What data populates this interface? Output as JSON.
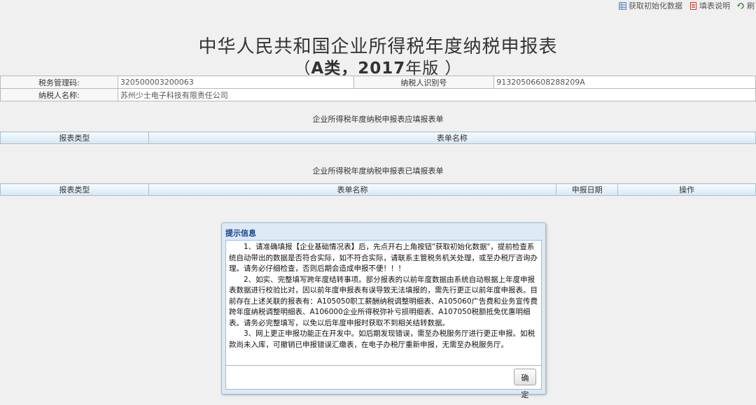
{
  "toolbar": {
    "init_data": "获取初始化数据",
    "instructions": "填表说明",
    "refresh": "刷"
  },
  "header": {
    "title": "中华人民共和国企业所得税年度纳税申报表",
    "subtitle_open": "（",
    "subtitle_type": "A类，2017",
    "subtitle_suffix": "年版 ）"
  },
  "taxpayer": {
    "tax_code_label": "税务管理码:",
    "tax_code_value": "320500003200063",
    "tax_id_label": "纳税人识别号",
    "tax_id_value": "91320506608288209A",
    "name_label": "纳税人名称:",
    "name_value": "苏州少士电子科技有限责任公司"
  },
  "pending_section": {
    "caption": "企业所得税年度纳税申报表应填报表单",
    "col_type": "报表类型",
    "col_name": "表单名称"
  },
  "filed_section": {
    "caption": "企业所得税年度纳税申报表已填报表单",
    "col_type": "报表类型",
    "col_name": "表单名称",
    "col_date": "申报日期",
    "col_action": "操作"
  },
  "dialog": {
    "title": "提示信息",
    "para1": "1、请准确填报【企业基础情况表】后，先点开右上角按钮\"获取初始化数据\"，提前检查系统自动带出的数据是否符合实际，如不符合实际，请联系主管税务机关处理，或至办税厅咨询办理。请务必仔细检查，否则后期会造成申报不便！！！",
    "para2": "2、如实、完整填写跨年度结转事项。部分报表的以前年度数据由系统自动根据上年度申报表数据进行校验比对，因以前年度申报表有误导致无法填报的，需先行更正以前年度申报表。目前存在上述关联的报表有：A105050职工薪酬纳税调整明细表、A105060广告费和业务宣传费跨年度纳税调整明细表、A106000企业所得税弥补亏损明细表、A107050税额抵免优惠明细表。请务必完整填写，以免以后年度申报时获取不到相关结转数据。",
    "para3": "3、网上更正申报功能正在开发中。如后期发现错误，需至办税服务厅进行更正申报。如税款尚未入库，可撤销已申报错误汇缴表，在电子办税厅重新申报，无需至办税服务厅。",
    "ok_label": "确定"
  },
  "icons": {
    "init_data": "grid-icon",
    "instructions": "document-icon",
    "refresh": "refresh-icon"
  }
}
